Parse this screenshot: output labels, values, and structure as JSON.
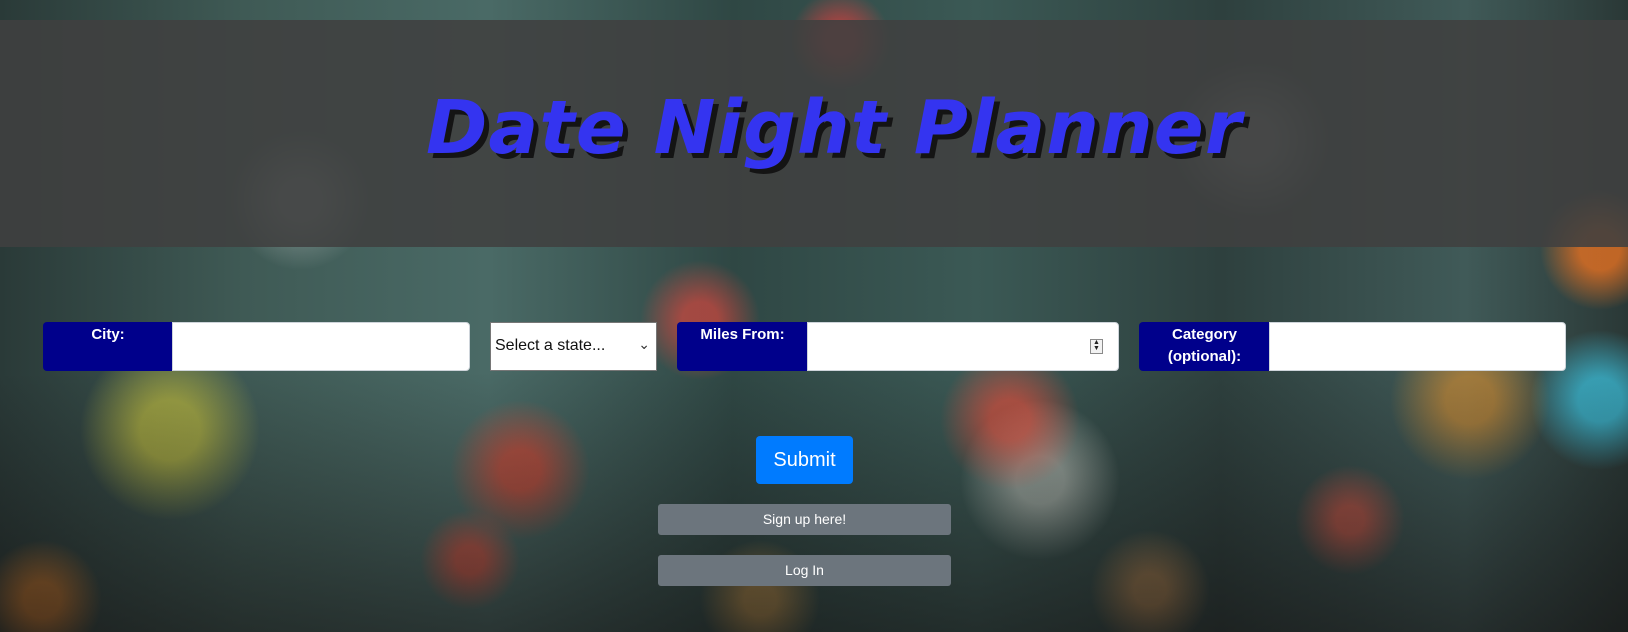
{
  "header": {
    "title": "Date Night Planner"
  },
  "form": {
    "city_label": "City:",
    "city_value": "",
    "state_selected": "Select a state...",
    "miles_label": "Miles From:",
    "miles_value": "",
    "category_label_line1": "Category",
    "category_label_line2": "(optional):",
    "category_value": ""
  },
  "actions": {
    "submit_label": "Submit",
    "signup_label": "Sign up here!",
    "login_label": "Log In"
  },
  "icons": {
    "select_arrow": "chevron-down-icon",
    "number_spinner": "spinner-icon"
  },
  "colors": {
    "title": "#3434f0",
    "label_bg": "#00008b",
    "submit_bg": "#007bff",
    "secondary_bg": "#6c757d",
    "header_bg": "#404040"
  }
}
